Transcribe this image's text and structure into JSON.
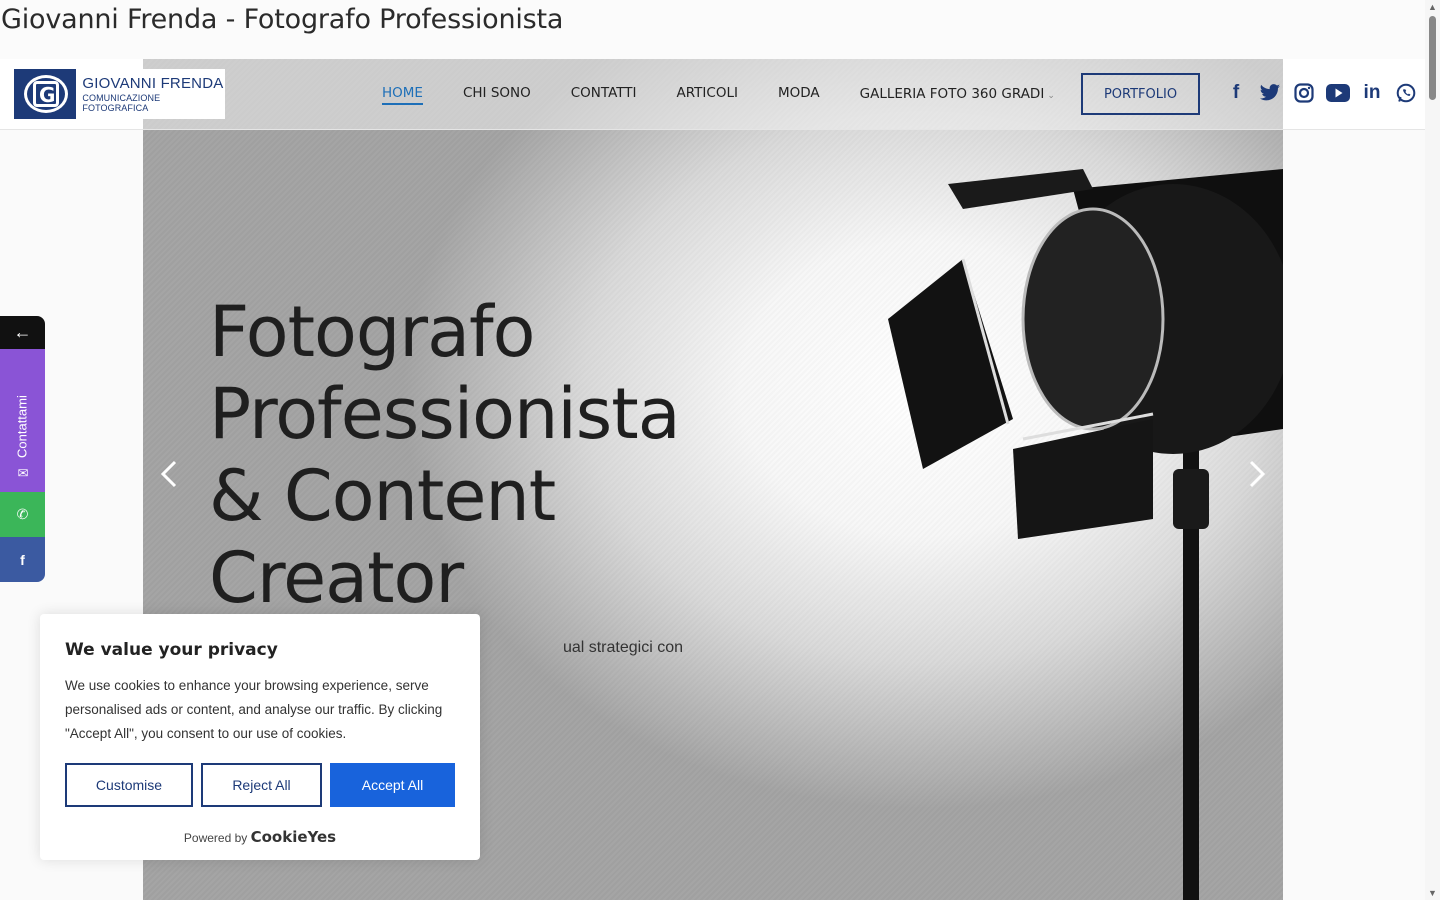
{
  "page": {
    "window_title": "Giovanni Frenda - Fotografo Professionista"
  },
  "header": {
    "logo": {
      "name": "GIOVANNI FRENDA",
      "tagline": "COMUNICAZIONE FOTOGRAFICA"
    },
    "nav": [
      {
        "label": "HOME",
        "active": true
      },
      {
        "label": "CHI SONO",
        "active": false
      },
      {
        "label": "CONTATTI",
        "active": false
      },
      {
        "label": "ARTICOLI",
        "active": false
      },
      {
        "label": "MODA",
        "active": false
      },
      {
        "label": "GALLERIA FOTO 360 GRADI",
        "active": false,
        "has_dropdown": true
      }
    ],
    "cta": "PORTFOLIO",
    "socials": [
      {
        "icon": "facebook-icon",
        "glyph": "f"
      },
      {
        "icon": "twitter-icon",
        "glyph": "🐦"
      },
      {
        "icon": "instagram-icon",
        "glyph": "◎"
      },
      {
        "icon": "youtube-icon",
        "glyph": "▶"
      },
      {
        "icon": "linkedin-icon",
        "glyph": "in"
      },
      {
        "icon": "whatsapp-icon",
        "glyph": "✆"
      }
    ]
  },
  "hero": {
    "heading_lines": [
      "Fotografo",
      "Professionista",
      "& Content",
      "Creator"
    ],
    "subtitle_visible": "ual strategici con"
  },
  "floating_widget": {
    "close_glyph": "←",
    "contact_label": "Contattami",
    "whatsapp_glyph": "✆",
    "facebook_glyph": "f"
  },
  "cookie_banner": {
    "title": "We value your privacy",
    "body": "We use cookies to enhance your browsing experience, serve personalised ads or content, and analyse our traffic. By clicking \"Accept All\", you consent to our use of cookies.",
    "buttons": {
      "customise": "Customise",
      "reject": "Reject All",
      "accept": "Accept All"
    },
    "powered_by": "Powered by",
    "brand": "CookieYes"
  },
  "colors": {
    "brand_navy": "#1d3a78",
    "nav_active": "#1d6fb8",
    "accept_blue": "#1863dc",
    "contact_purple": "#8a54d6",
    "whatsapp_green": "#3bb659",
    "facebook_blue": "#3b5aa1"
  }
}
